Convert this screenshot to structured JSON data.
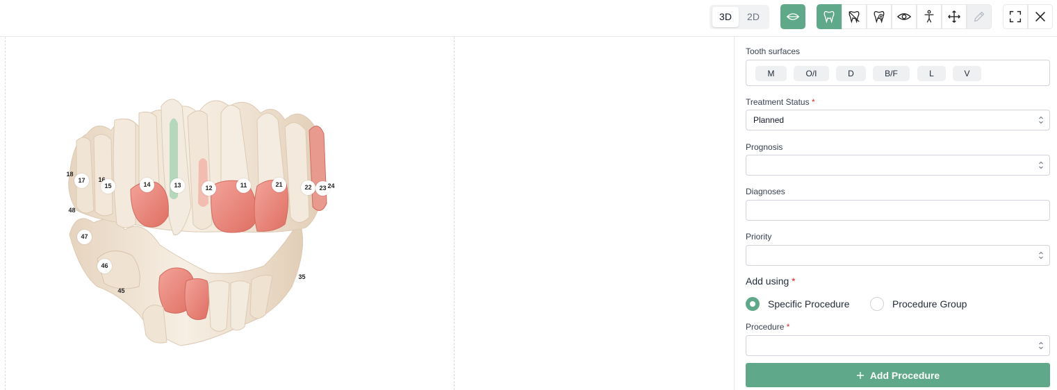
{
  "toolbar": {
    "view_modes": [
      "3D",
      "2D"
    ],
    "active_view_mode": "3D",
    "tools": [
      "mouth-icon",
      "tooth-icon",
      "tooth-crossed-icon",
      "tooth-plus-icon",
      "eye-icon",
      "person-icon",
      "move-icon",
      "pencil-icon"
    ],
    "window_tools": [
      "fullscreen-icon",
      "close-icon"
    ]
  },
  "viewer": {
    "tooth_labels": [
      "18",
      "17",
      "16",
      "15",
      "14",
      "13",
      "12",
      "11",
      "21",
      "22",
      "23",
      "24",
      "48",
      "47",
      "46",
      "45",
      "35"
    ]
  },
  "panel": {
    "tooth_surfaces_label": "Tooth surfaces",
    "surfaces": [
      "M",
      "O/I",
      "D",
      "B/F",
      "L",
      "V"
    ],
    "treatment_status_label": "Treatment Status",
    "treatment_status_value": "Planned",
    "prognosis_label": "Prognosis",
    "prognosis_value": "",
    "diagnoses_label": "Diagnoses",
    "diagnoses_value": "",
    "priority_label": "Priority",
    "priority_value": "",
    "add_using_label": "Add using",
    "add_using_options": [
      "Specific Procedure",
      "Procedure Group"
    ],
    "add_using_selected": "Specific Procedure",
    "procedure_label": "Procedure",
    "procedure_value": "",
    "add_button_label": "Add Procedure",
    "required_mark": "*"
  },
  "colors": {
    "accent": "#5fa98a",
    "treated_tooth": "#e8857a",
    "root_canal": "#a9d3b5",
    "tooth": "#efe3d3",
    "required": "#dc2626"
  }
}
